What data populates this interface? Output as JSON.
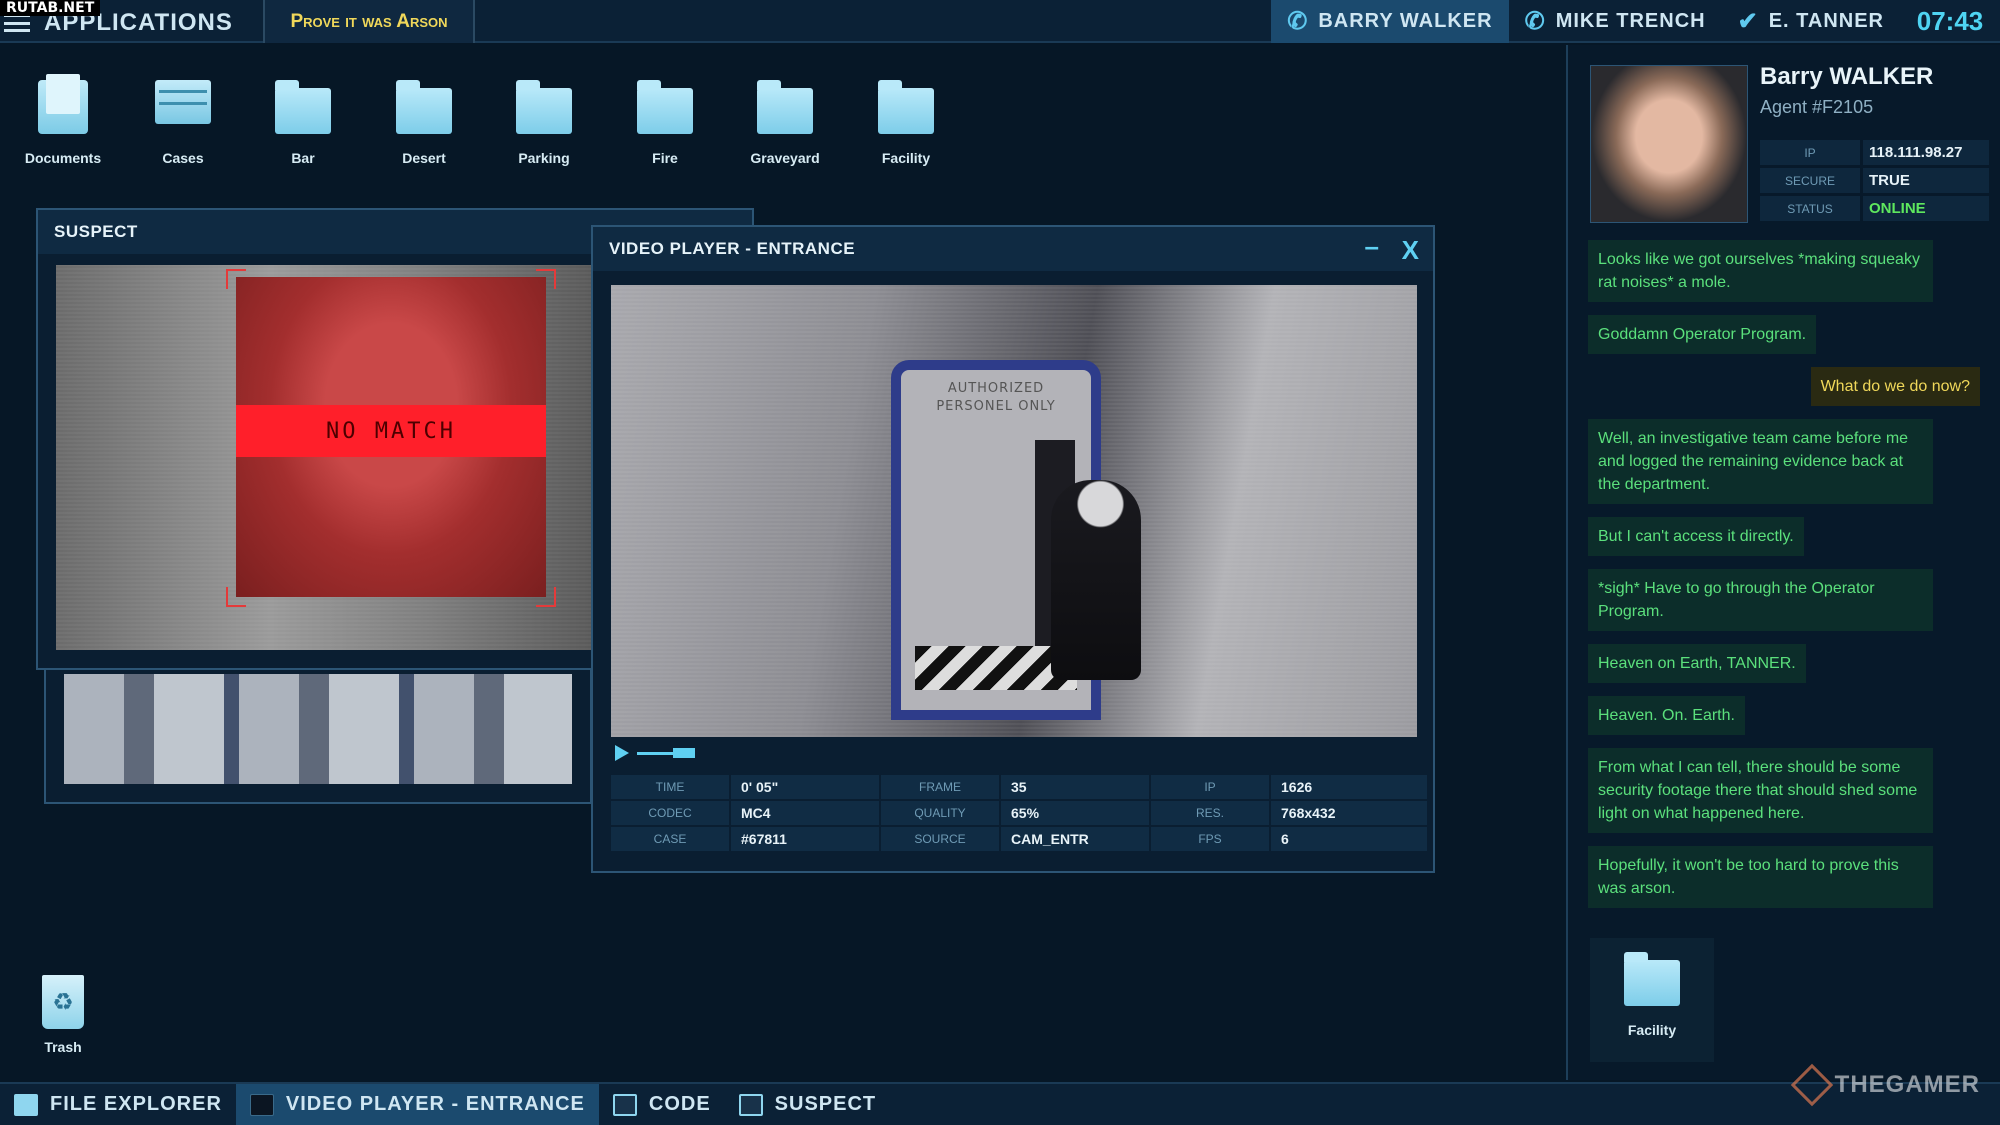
{
  "watermark": "RUTAB.NET",
  "topbar": {
    "apps_label": "Applications",
    "case_tab": "Prove it was Arson",
    "contacts": [
      "BARRY WALKER",
      "MIKE TRENCH",
      "E. TANNER"
    ],
    "clock": "07:43"
  },
  "desktop": {
    "icons": [
      "Documents",
      "Cases",
      "Bar",
      "Desert",
      "Parking",
      "Fire",
      "Graveyard",
      "Facility"
    ],
    "trash": "Trash"
  },
  "suspect_window": {
    "title": "SUSPECT",
    "status": "NO MATCH"
  },
  "video_window": {
    "title": "VIDEO PLAYER - ENTRANCE",
    "minimize": "–",
    "close": "X",
    "door_sign": "AUTHORIZED PERSONEL ONLY",
    "meta": [
      {
        "k": "TIME",
        "v": "0' 05\""
      },
      {
        "k": "FRAME",
        "v": "35"
      },
      {
        "k": "IP",
        "v": "1626"
      },
      {
        "k": "CODEC",
        "v": "MC4"
      },
      {
        "k": "QUALITY",
        "v": "65%"
      },
      {
        "k": "RES.",
        "v": "768x432"
      },
      {
        "k": "CASE",
        "v": "#67811"
      },
      {
        "k": "SOURCE",
        "v": "CAM_ENTR"
      },
      {
        "k": "FPS",
        "v": "6"
      }
    ]
  },
  "agent": {
    "name": "Barry WALKER",
    "id": "Agent #F2105",
    "info": [
      {
        "k": "IP",
        "v": "118.111.98.27"
      },
      {
        "k": "SECURE",
        "v": "TRUE"
      },
      {
        "k": "STATUS",
        "v": "ONLINE"
      }
    ],
    "messages": [
      "Looks like we got ourselves *making squeaky rat noises* a mole.",
      "Goddamn Operator Program.",
      "What do we do now?",
      "Well, an investigative team came before me and logged the remaining evidence back at the department.",
      "But I can't access it directly.",
      "*sigh* Have to go through the Operator Program.",
      "Heaven on Earth, TANNER.",
      "Heaven. On. Earth.",
      "From what I can tell, there should be some security footage there that should shed some light on what happened here.",
      "Hopefully, it won't be too hard to prove this was arson."
    ],
    "attachment": "Facility"
  },
  "taskbar": [
    "FILE EXPLORER",
    "VIDEO PLAYER - ENTRANCE",
    "CODE",
    "SUSPECT"
  ],
  "logo_watermark": "THEGAMER"
}
